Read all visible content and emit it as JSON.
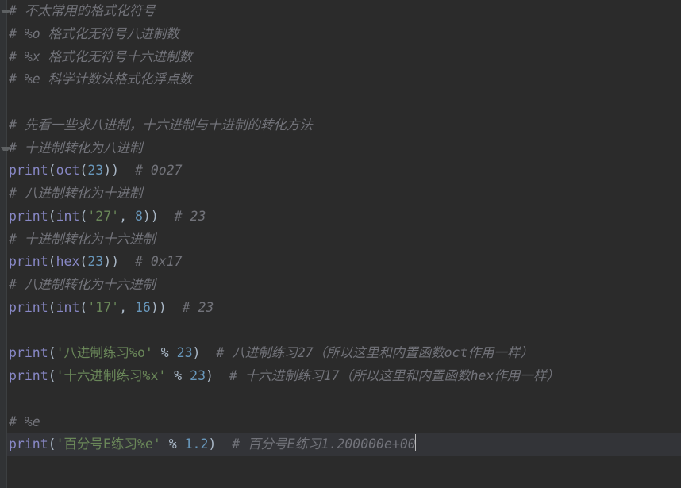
{
  "editor": {
    "language": "python",
    "theme": "darcula",
    "current_line_index": 19,
    "lines": [
      {
        "fold": true,
        "tokens": [
          [
            "cm",
            "# 不太常用的格式化符号"
          ]
        ]
      },
      {
        "tokens": [
          [
            "cm",
            "# %o 格式化无符号八进制数"
          ]
        ]
      },
      {
        "tokens": [
          [
            "cm",
            "# %x 格式化无符号十六进制数"
          ]
        ]
      },
      {
        "tokens": [
          [
            "cm",
            "# %e 科学计数法格式化浮点数"
          ]
        ]
      },
      {
        "tokens": []
      },
      {
        "tokens": [
          [
            "cm",
            "# 先看一些求八进制，十六进制与十进制的转化方法"
          ]
        ]
      },
      {
        "fold": true,
        "tokens": [
          [
            "cm",
            "# 十进制转化为八进制"
          ]
        ]
      },
      {
        "tokens": [
          [
            "fn",
            "print"
          ],
          [
            "op",
            "("
          ],
          [
            "fn",
            "oct"
          ],
          [
            "op",
            "("
          ],
          [
            "num",
            "23"
          ],
          [
            "op",
            "))  "
          ],
          [
            "cm",
            "# 0o27"
          ]
        ]
      },
      {
        "tokens": [
          [
            "cm",
            "# 八进制转化为十进制"
          ]
        ]
      },
      {
        "tokens": [
          [
            "fn",
            "print"
          ],
          [
            "op",
            "("
          ],
          [
            "fn",
            "int"
          ],
          [
            "op",
            "("
          ],
          [
            "str",
            "'27'"
          ],
          [
            "op",
            ", "
          ],
          [
            "num",
            "8"
          ],
          [
            "op",
            "))  "
          ],
          [
            "cm",
            "# 23"
          ]
        ]
      },
      {
        "tokens": [
          [
            "cm",
            "# 十进制转化为十六进制"
          ]
        ]
      },
      {
        "tokens": [
          [
            "fn",
            "print"
          ],
          [
            "op",
            "("
          ],
          [
            "fn",
            "hex"
          ],
          [
            "op",
            "("
          ],
          [
            "num",
            "23"
          ],
          [
            "op",
            "))  "
          ],
          [
            "cm",
            "# 0x17"
          ]
        ]
      },
      {
        "tokens": [
          [
            "cm",
            "# 八进制转化为十六进制"
          ]
        ]
      },
      {
        "tokens": [
          [
            "fn",
            "print"
          ],
          [
            "op",
            "("
          ],
          [
            "fn",
            "int"
          ],
          [
            "op",
            "("
          ],
          [
            "str",
            "'17'"
          ],
          [
            "op",
            ", "
          ],
          [
            "num",
            "16"
          ],
          [
            "op",
            "))  "
          ],
          [
            "cm",
            "# 23"
          ]
        ]
      },
      {
        "tokens": []
      },
      {
        "tokens": [
          [
            "fn",
            "print"
          ],
          [
            "op",
            "("
          ],
          [
            "str",
            "'八进制练习%o'"
          ],
          [
            "op",
            " % "
          ],
          [
            "num",
            "23"
          ],
          [
            "op",
            ")  "
          ],
          [
            "cm",
            "# 八进制练习27（所以这里和内置函数oct作用一样）"
          ]
        ]
      },
      {
        "tokens": [
          [
            "fn",
            "print"
          ],
          [
            "op",
            "("
          ],
          [
            "str",
            "'十六进制练习%x'"
          ],
          [
            "op",
            " % "
          ],
          [
            "num",
            "23"
          ],
          [
            "op",
            ")  "
          ],
          [
            "cm",
            "# 十六进制练习17（所以这里和内置函数hex作用一样）"
          ]
        ]
      },
      {
        "tokens": []
      },
      {
        "tokens": [
          [
            "cm",
            "# %e"
          ]
        ]
      },
      {
        "current": true,
        "tokens": [
          [
            "fn",
            "print"
          ],
          [
            "op",
            "("
          ],
          [
            "str",
            "'百分号E练习%e'"
          ],
          [
            "op",
            " % "
          ],
          [
            "num",
            "1.2"
          ],
          [
            "op",
            ")  "
          ],
          [
            "cm",
            "# 百分号E练习1.200000e+00"
          ]
        ],
        "caret_after": true
      }
    ]
  }
}
